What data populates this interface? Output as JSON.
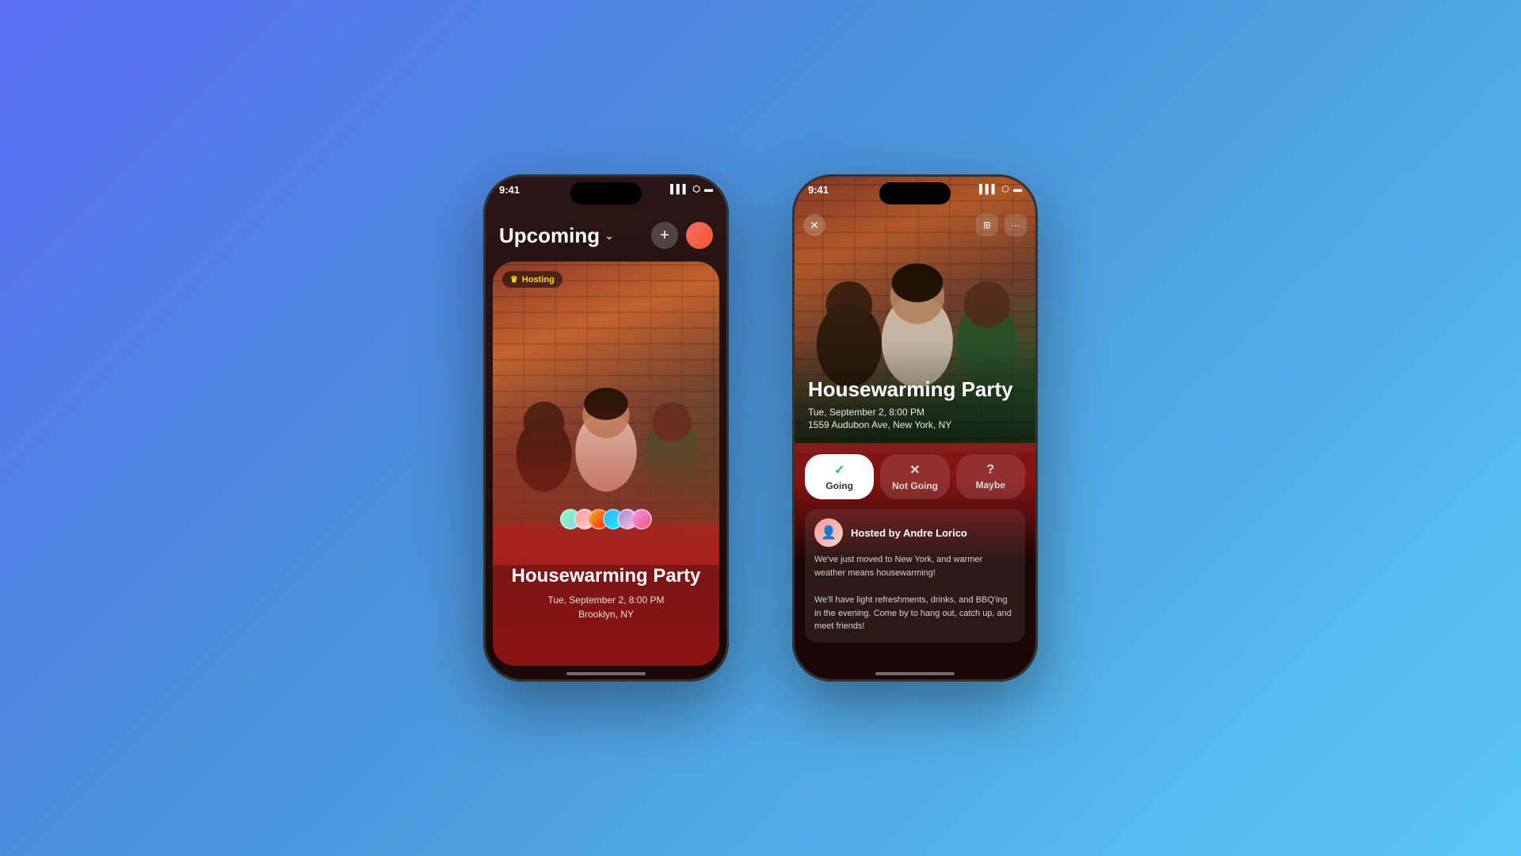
{
  "background": {
    "gradient_start": "#5B6EF5",
    "gradient_end": "#5BC8F5"
  },
  "phone1": {
    "status": {
      "time": "9:41",
      "signal": "▌▌▌",
      "wifi": "WiFi",
      "battery": "Battery"
    },
    "header": {
      "title": "Upcoming",
      "chevron": "›",
      "add_label": "+",
      "add_aria": "Add event button"
    },
    "event": {
      "badge": "Hosting",
      "crown": "♛",
      "title": "Housewarming\nParty",
      "title_line1": "Housewarming Party",
      "date": "Tue, September 2, 8:00 PM",
      "location": "Brooklyn, NY"
    }
  },
  "phone2": {
    "status": {
      "time": "9:41"
    },
    "close_label": "✕",
    "event": {
      "title": "Housewarming Party",
      "date": "Tue, September 2, 8:00 PM",
      "location": "1559 Audubon Ave, New York, NY"
    },
    "rsvp": {
      "going_label": "Going",
      "going_active": true,
      "not_going_label": "Not Going",
      "maybe_label": "Maybe"
    },
    "description": {
      "host_label": "Hosted by Andre Lorico",
      "host_name": "Andre Lorico",
      "text_line1": "We've just moved to New York, and warmer weather means housewarming!",
      "text_line2": "We'll have light refreshments, drinks, and BBQ'ing in the evening. Come by to hang out, catch up, and meet friends!"
    }
  }
}
